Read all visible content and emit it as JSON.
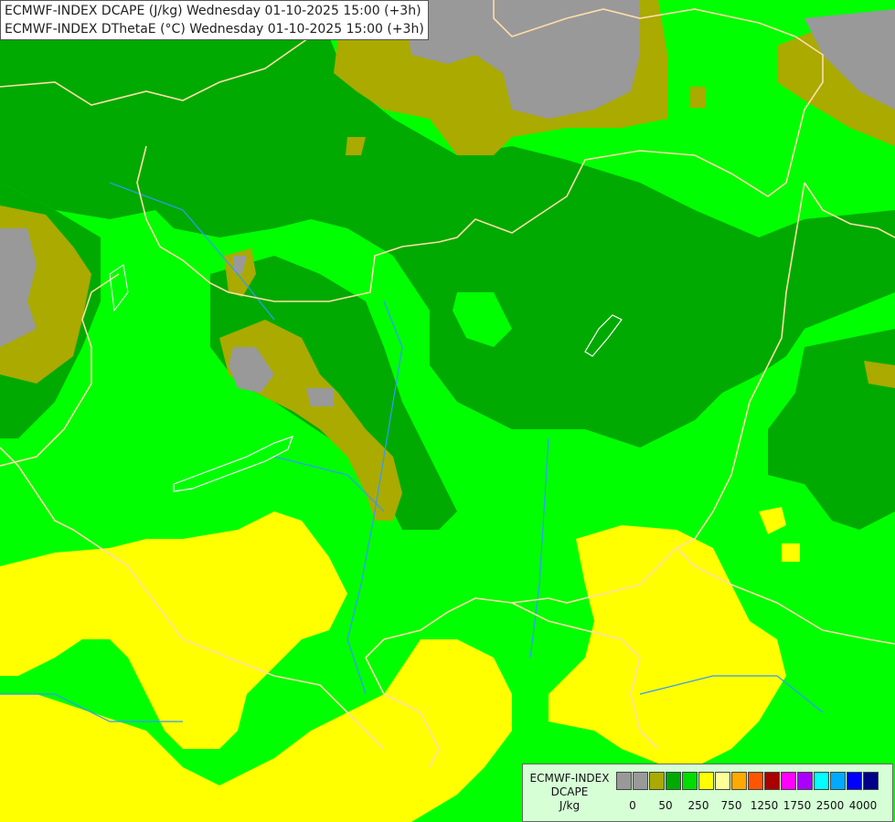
{
  "titles": [
    "ECMWF-INDEX DCAPE (J/kg) Wednesday 01-10-2025 15:00 (+3h)",
    "ECMWF-INDEX DThetaE (°C) Wednesday 01-10-2025 15:00 (+3h)"
  ],
  "legend": {
    "line1": "ECMWF-INDEX",
    "line2": "DCAPE",
    "line3": "J/kg",
    "colors": [
      "#999999",
      "#999999",
      "#aaaa00",
      "#00aa00",
      "#00dd00",
      "#ffff00",
      "#ffff99",
      "#ffaa00",
      "#ff5500",
      "#aa0000",
      "#ff00ff",
      "#aa00ff",
      "#00ffff",
      "#00aaff",
      "#0000ff",
      "#000088"
    ],
    "ticks": [
      "0",
      "50",
      "250",
      "750",
      "1250",
      "1750",
      "2500",
      "4000"
    ]
  },
  "palette": {
    "gray": "#999999",
    "olive": "#aaaa00",
    "dark_green": "#00aa00",
    "green": "#00ff00",
    "yellow": "#ffff00",
    "border": "#ffddaa",
    "river": "#3399ff"
  }
}
